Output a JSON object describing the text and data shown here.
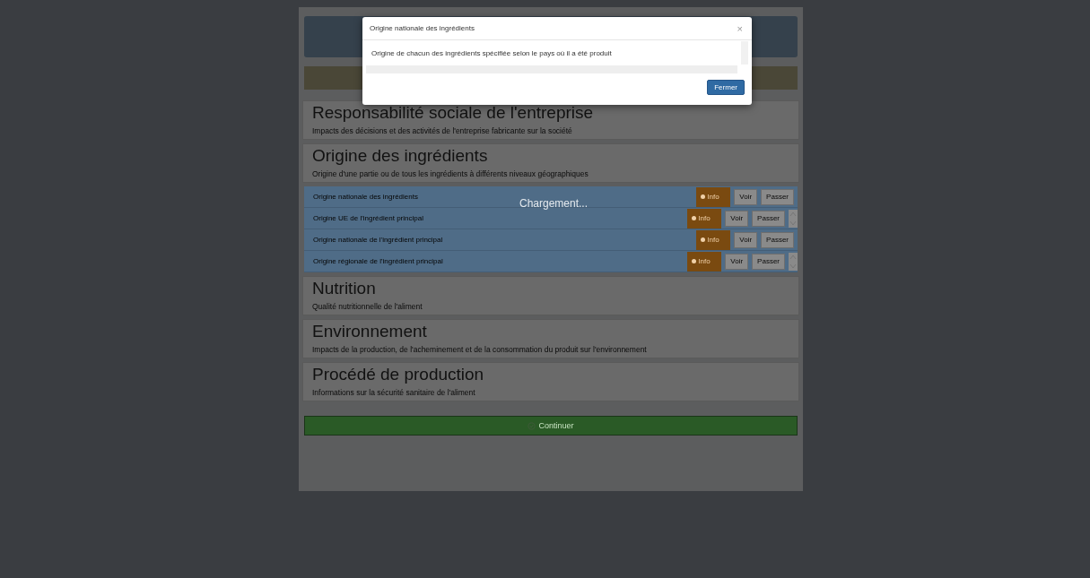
{
  "modal": {
    "title": "Origine nationale des ingrédients",
    "close": "×",
    "body": "Origine de chacun des ingrédients spécifiée selon le pays où il a été produit",
    "button": "Fermer"
  },
  "loading": "Chargement...",
  "sections": [
    {
      "title": "Responsabilité sociale de l'entreprise",
      "description": "Impacts des décisions et des activités de l'entreprise fabricante sur la société"
    },
    {
      "title": "Origine des ingrédients",
      "description": "Origine d'une partie ou de tous les ingrédients à différents niveaux géographiques",
      "criteria": [
        {
          "label": "Origine nationale des ingrédients",
          "info": "Info",
          "view": "Voir",
          "skip": "Passer",
          "reorder": false
        },
        {
          "label": "Origine UE de l'ingrédient principal",
          "info": "Info",
          "view": "Voir",
          "skip": "Passer",
          "reorder": true
        },
        {
          "label": "Origine nationale de l'ingrédient principal",
          "info": "Info",
          "view": "Voir",
          "skip": "Passer",
          "reorder": false
        },
        {
          "label": "Origine régionale de l'ingrédient principal",
          "info": "Info",
          "view": "Voir",
          "skip": "Passer",
          "reorder": true
        }
      ]
    },
    {
      "title": "Nutrition",
      "description": "Qualité nutritionnelle de l'aliment"
    },
    {
      "title": "Environnement",
      "description": "Impacts de la production, de l'acheminement et de la consommation du produit sur l'environnement"
    },
    {
      "title": "Procédé de production",
      "description": "Informations sur la sécurité sanitaire de l'aliment"
    }
  ],
  "continue": "Continuer"
}
